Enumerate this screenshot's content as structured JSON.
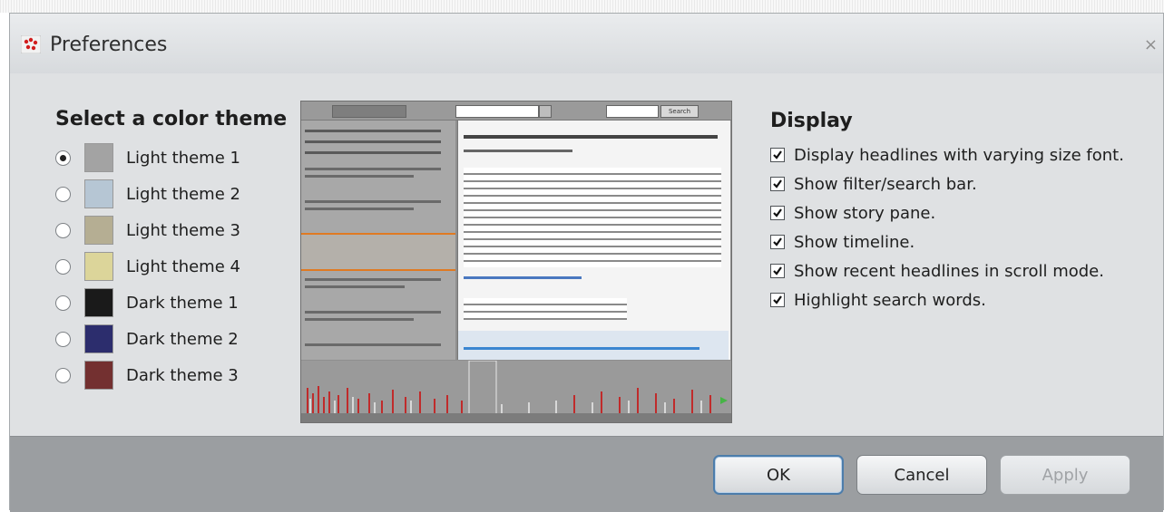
{
  "dialog": {
    "title": "Preferences",
    "close_glyph": "×"
  },
  "themes": {
    "heading": "Select a color theme",
    "items": [
      {
        "label": "Light theme 1",
        "color": "#a3a3a3",
        "selected": true
      },
      {
        "label": "Light theme 2",
        "color": "#b6c6d4",
        "selected": false
      },
      {
        "label": "Light theme 3",
        "color": "#b5ae93",
        "selected": false
      },
      {
        "label": "Light theme 4",
        "color": "#dcd59a",
        "selected": false
      },
      {
        "label": "Dark theme 1",
        "color": "#1a1a1a",
        "selected": false
      },
      {
        "label": "Dark theme 2",
        "color": "#2c2d6d",
        "selected": false
      },
      {
        "label": "Dark theme 3",
        "color": "#733030",
        "selected": false
      }
    ]
  },
  "display": {
    "heading": "Display",
    "options": [
      {
        "label": "Display headlines with varying size font.",
        "checked": true
      },
      {
        "label": "Show filter/search bar.",
        "checked": true
      },
      {
        "label": "Show story pane.",
        "checked": true
      },
      {
        "label": "Show timeline.",
        "checked": true
      },
      {
        "label": "Show recent headlines in scroll mode.",
        "checked": true
      },
      {
        "label": "Highlight search words.",
        "checked": true
      }
    ]
  },
  "buttons": {
    "ok": "OK",
    "cancel": "Cancel",
    "apply": "Apply"
  },
  "icons": {
    "app": "preferences-app-icon",
    "close": "close-icon",
    "radio": "radio-button",
    "check": "checkmark-icon"
  },
  "preview": {
    "search_button": "Search"
  }
}
